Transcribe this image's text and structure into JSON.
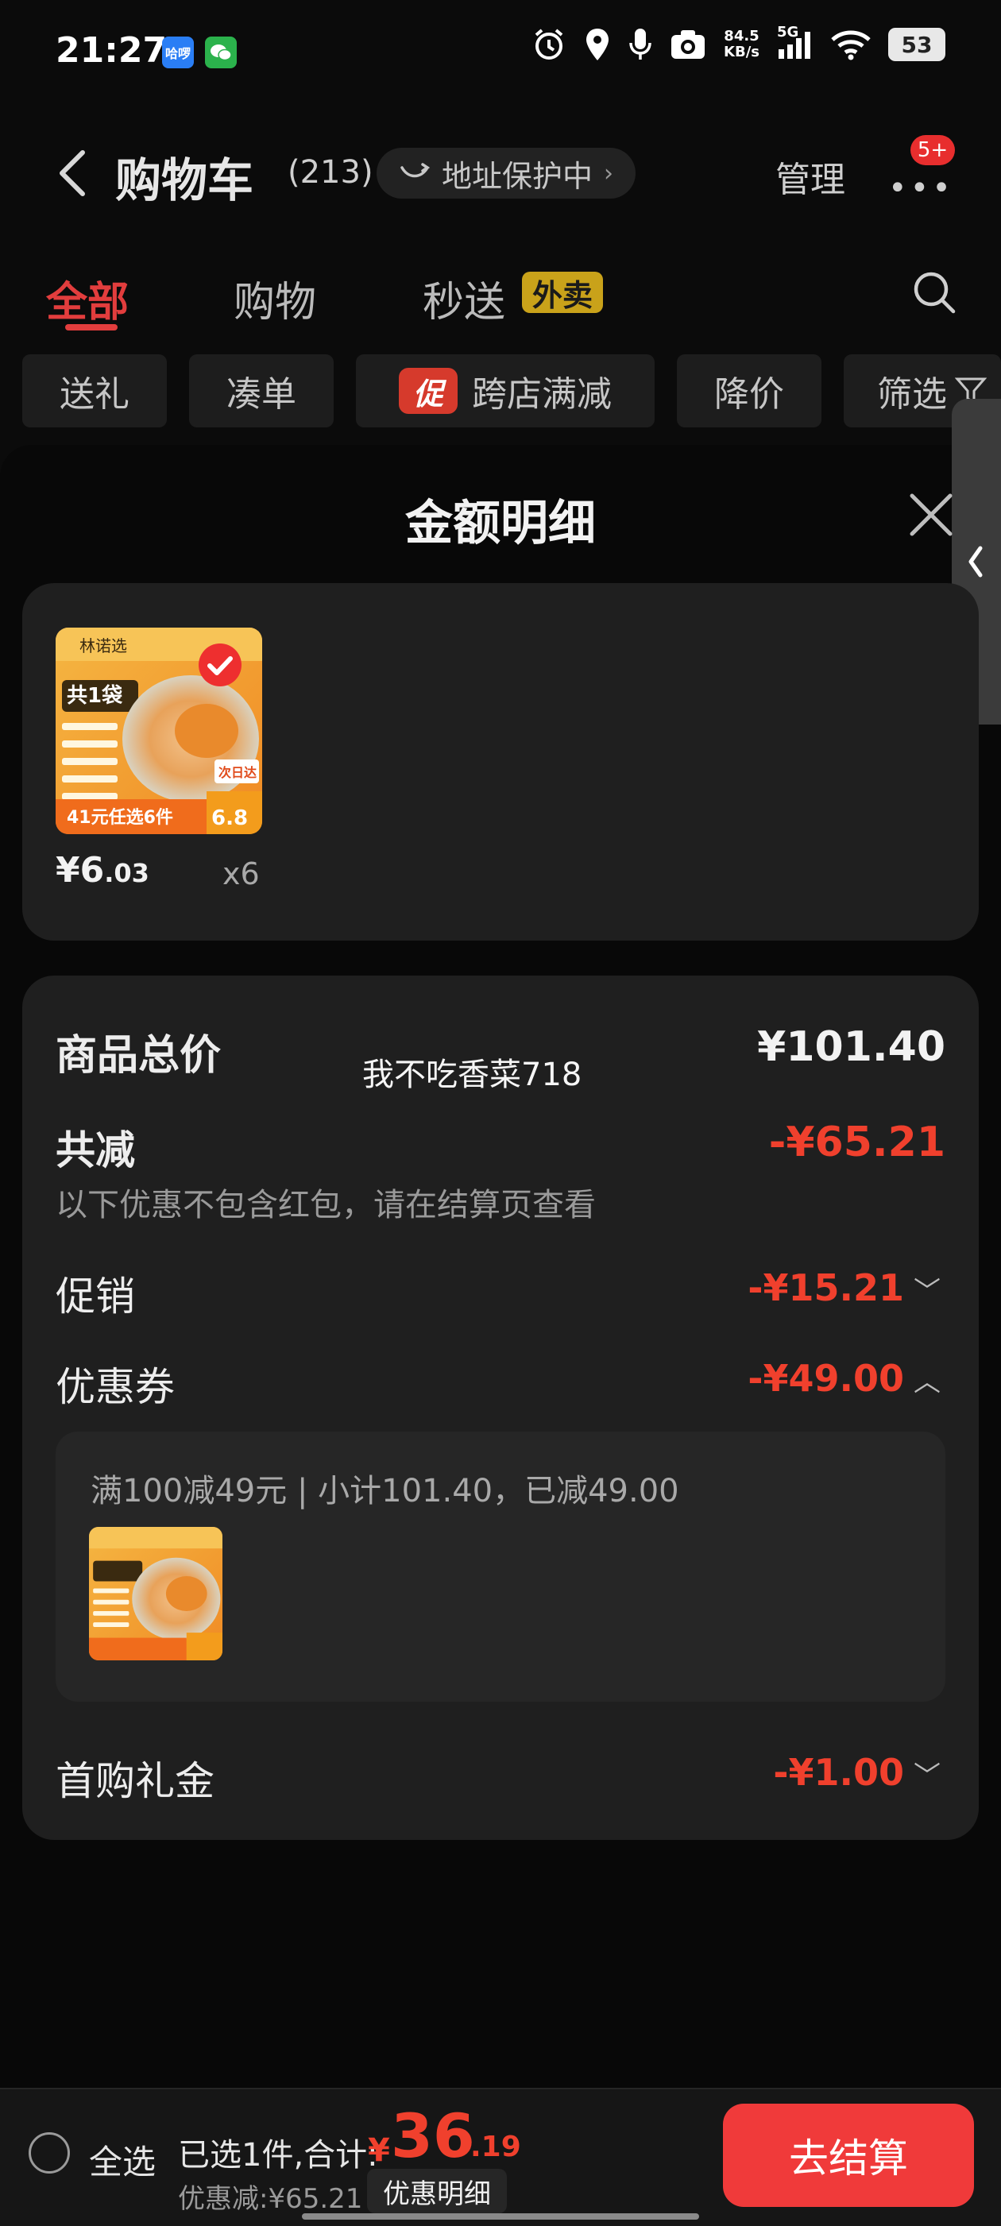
{
  "status_bar": {
    "time": "21:27",
    "app_badge_1": "哈啰",
    "speed_value": "84.5",
    "speed_unit": "KB/s",
    "network": "5G",
    "battery": "53"
  },
  "header": {
    "title": "购物车",
    "count": "(213)",
    "address_protect": "地址保护中",
    "manage": "管理",
    "more_badge": "5+"
  },
  "tabs": [
    {
      "label": "全部",
      "active": true
    },
    {
      "label": "购物",
      "active": false
    },
    {
      "label": "秒送",
      "active": false
    }
  ],
  "tab_badge": "外卖",
  "filters": [
    "送礼",
    "凑单",
    "跨店满减",
    "降价",
    "筛选"
  ],
  "promo_tag": "促",
  "sheet": {
    "title": "金额明细",
    "item": {
      "price_symbol": "¥",
      "price_int": "6",
      "price_dec": ".03",
      "qty": "x6",
      "thumb_brand": "林诺选",
      "thumb_pack": "共1袋",
      "thumb_deal": "41元任选6件",
      "thumb_price": "6.8",
      "thumb_tag": "次日达"
    },
    "watermark": "我不吃香菜718",
    "rows": {
      "total_label": "商品总价",
      "total_value": "¥101.40",
      "reduce_label": "共减",
      "reduce_value": "-¥65.21",
      "note": "以下优惠不包含红包，请在结算页查看",
      "promo_label": "促销",
      "promo_value": "-¥15.21",
      "coupon_label": "优惠券",
      "coupon_value": "-¥49.00",
      "coupon_detail": "满100减49元 | 小计101.40，已减49.00",
      "first_label": "首购礼金",
      "first_value": "-¥1.00"
    }
  },
  "bottom": {
    "select_all": "全选",
    "selected": "已选1件,合计:",
    "symbol": "¥",
    "total_int": "36",
    "total_dec": ".19",
    "discount": "优惠减:¥65.21",
    "detail_button": "优惠明细",
    "checkout": "去结算"
  },
  "colors": {
    "accent_red": "#f0402d",
    "tab_red": "#e23d3d",
    "checkout_red": "#f03a3a",
    "gold_badge": "#c9a21a",
    "card_bg": "#1f1f1f"
  }
}
